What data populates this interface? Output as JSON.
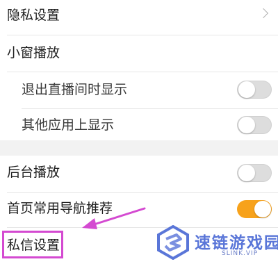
{
  "settings": {
    "privacy": {
      "label": "隐私设置",
      "icon": "chevron-right-icon"
    },
    "mini_window": {
      "label": "小窗播放"
    },
    "exit_live_show": {
      "label": "退出直播间时显示",
      "toggle_on": false
    },
    "other_app_show": {
      "label": "其他应用上显示",
      "toggle_on": false
    },
    "background_play": {
      "label": "后台播放",
      "toggle_on": false
    },
    "home_nav_recommend": {
      "label": "首页常用导航推荐",
      "toggle_on": true
    },
    "private_message": {
      "label": "私信设置"
    }
  },
  "annotation": {
    "color": "#d44ad1"
  },
  "watermark": {
    "title": "速链游戏园",
    "url": "SLINK.VIP"
  },
  "colors": {
    "toggle_on": "#f7a21b",
    "toggle_off": "#dddddd",
    "section_gap": "#f2f2f2"
  }
}
